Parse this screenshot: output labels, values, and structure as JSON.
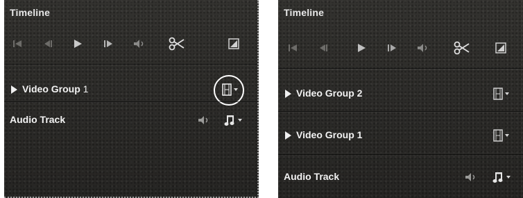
{
  "left_panel": {
    "title": "Timeline",
    "transport": [
      "skip-to-start-icon",
      "step-back-icon",
      "play-icon",
      "step-forward-icon",
      "volume-icon",
      "scissors-icon",
      "fit-icon"
    ],
    "rows": [
      {
        "label": "Video Group",
        "number": "1",
        "control": "film-icon",
        "highlighted": true
      },
      {
        "label": "Audio Track",
        "control": "music-note-icon"
      }
    ]
  },
  "right_panel": {
    "title": "Timeline",
    "transport": [
      "skip-to-start-icon",
      "step-back-icon",
      "play-icon",
      "step-forward-icon",
      "volume-icon",
      "scissors-icon",
      "fit-icon"
    ],
    "rows": [
      {
        "label": "Video Group 2",
        "control": "film-icon"
      },
      {
        "label": "Video Group 1",
        "control": "film-icon"
      },
      {
        "label": "Audio Track",
        "control": "music-note-icon"
      }
    ]
  },
  "colors": {
    "panel": "#2b2a28",
    "text": "#f2f2f2",
    "highlight_ring": "#ffffff"
  }
}
